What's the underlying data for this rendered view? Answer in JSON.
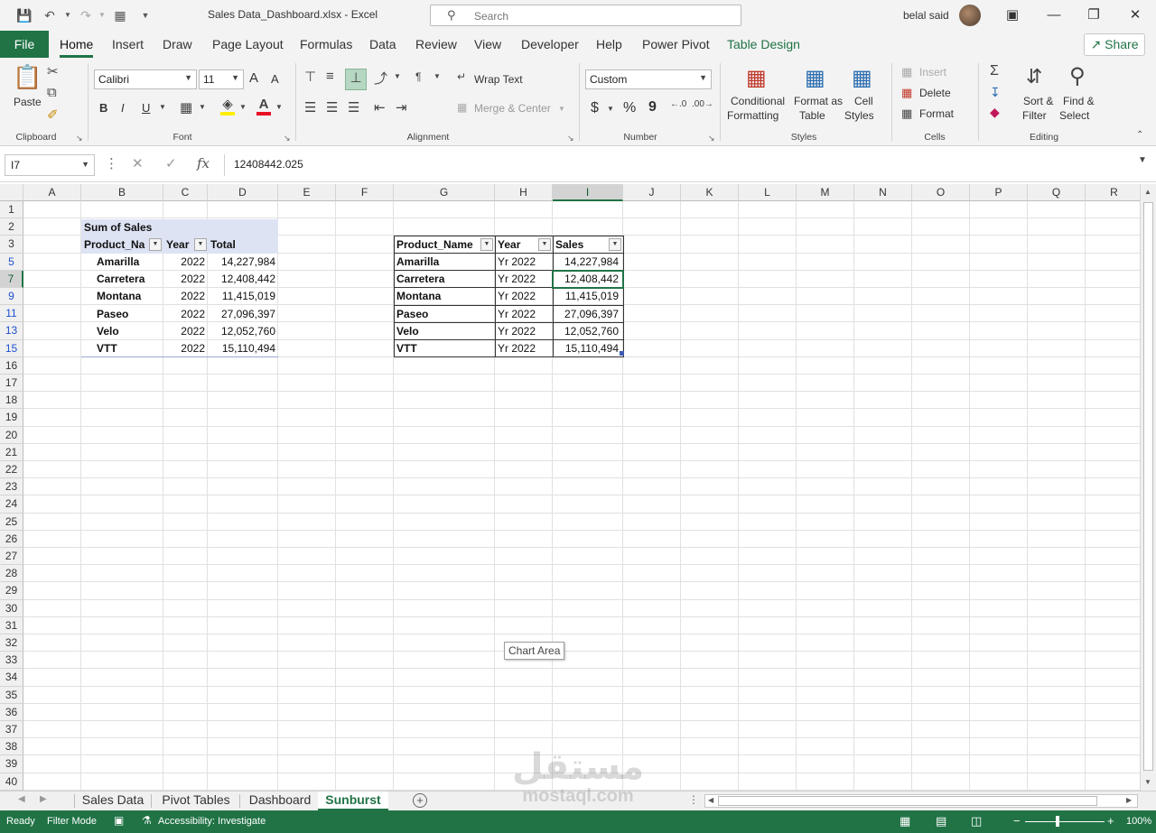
{
  "titlebar": {
    "title": "Sales Data_Dashboard.xlsx  -  Excel",
    "search_placeholder": "Search",
    "user": "belal said"
  },
  "ribbon_tabs": [
    "File",
    "Home",
    "Insert",
    "Draw",
    "Page Layout",
    "Formulas",
    "Data",
    "Review",
    "View",
    "Developer",
    "Help",
    "Power Pivot",
    "Table Design"
  ],
  "share_label": "Share",
  "clipboard": {
    "paste": "Paste",
    "label": "Clipboard"
  },
  "font": {
    "name": "Calibri",
    "size": "11",
    "label": "Font",
    "bold": "B",
    "italic": "I",
    "underline": "U",
    "grow": "A",
    "shrink": "A"
  },
  "alignment": {
    "wrap": "Wrap Text",
    "merge": "Merge & Center",
    "label": "Alignment"
  },
  "number": {
    "format": "Custom",
    "label": "Number",
    "currency": "$",
    "percent": "%",
    "comma": "9"
  },
  "styles": {
    "conditional_1": "Conditional",
    "conditional_2": "Formatting",
    "format_table_1": "Format as",
    "format_table_2": "Table",
    "cell_styles_1": "Cell",
    "cell_styles_2": "Styles",
    "label": "Styles"
  },
  "cells": {
    "insert": "Insert",
    "delete": "Delete",
    "format": "Format",
    "label": "Cells"
  },
  "editing": {
    "sort_1": "Sort &",
    "sort_2": "Filter",
    "find_1": "Find &",
    "find_2": "Select",
    "label": "Editing"
  },
  "formula_bar": {
    "name_box": "I7",
    "fx": "fx",
    "value": "12408442.025"
  },
  "columns": [
    "A",
    "B",
    "C",
    "D",
    "E",
    "F",
    "G",
    "H",
    "I",
    "J",
    "K",
    "L",
    "M",
    "N",
    "O",
    "P",
    "Q",
    "R"
  ],
  "rows": [
    "1",
    "2",
    "3",
    "5",
    "7",
    "9",
    "11",
    "13",
    "15",
    "16",
    "17",
    "18",
    "19",
    "20",
    "21",
    "22",
    "23",
    "24",
    "25",
    "26",
    "27",
    "28",
    "29",
    "30",
    "31",
    "32",
    "33",
    "34",
    "35",
    "36",
    "37",
    "38",
    "39",
    "40"
  ],
  "pivot": {
    "title": "Sum of Sales",
    "headers": [
      "Product_Na",
      "Year",
      "Total"
    ],
    "rows": [
      [
        "Amarilla",
        "2022",
        "14,227,984"
      ],
      [
        "Carretera",
        "2022",
        "12,408,442"
      ],
      [
        "Montana",
        "2022",
        "11,415,019"
      ],
      [
        "Paseo",
        "2022",
        "27,096,397"
      ],
      [
        "Velo",
        "2022",
        "12,052,760"
      ],
      [
        "VTT",
        "2022",
        "15,110,494"
      ]
    ]
  },
  "table": {
    "headers": [
      "Product_Name",
      "Year",
      "Sales"
    ],
    "rows": [
      [
        "Amarilla",
        "Yr 2022",
        "14,227,984"
      ],
      [
        "Carretera",
        "Yr 2022",
        "12,408,442"
      ],
      [
        "Montana",
        "Yr 2022",
        "11,415,019"
      ],
      [
        "Paseo",
        "Yr 2022",
        "27,096,397"
      ],
      [
        "Velo",
        "Yr 2022",
        "12,052,760"
      ],
      [
        "VTT",
        "Yr 2022",
        "15,110,494"
      ]
    ]
  },
  "tooltip": "Chart Area",
  "sheets": [
    "Sales Data",
    "Pivot Tables",
    "Dashboard",
    "Sunburst"
  ],
  "active_sheet": "Sunburst",
  "status": {
    "ready": "Ready",
    "filter_mode": "Filter Mode",
    "accessibility": "Accessibility: Investigate",
    "zoom": "100%"
  },
  "watermark": {
    "arabic": "مستقل",
    "latin": "mostaql.com"
  },
  "colors": {
    "excel_green": "#217346",
    "pivot_header": "#dde3f3"
  }
}
